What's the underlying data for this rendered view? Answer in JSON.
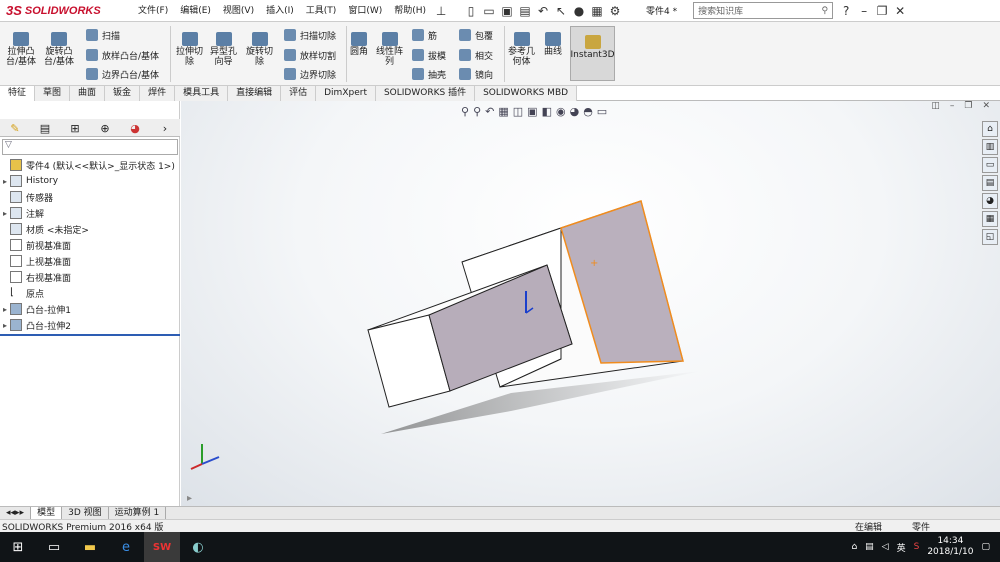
{
  "app": {
    "brand": "SOLIDWORKS"
  },
  "menubar": {
    "items": [
      "文件(F)",
      "编辑(E)",
      "视图(V)",
      "插入(I)",
      "工具(T)",
      "窗口(W)",
      "帮助(H)"
    ],
    "doc_title": "零件4 *",
    "search_placeholder": "搜索知识库"
  },
  "ribbon": {
    "large": [
      "拉伸凸\n台/基体",
      "旋转凸\n台/基体",
      "拉伸切\n除",
      "异型孔\n向导",
      "旋转切\n除",
      "圆角",
      "线性阵\n列",
      "参考几\n何体",
      "曲线"
    ],
    "small": [
      "扫描",
      "放样凸台/基体",
      "边界凸台/基体",
      "扫描切除",
      "放样切割",
      "边界切除",
      "筋",
      "拔模",
      "抽壳",
      "包覆",
      "相交",
      "镜向"
    ],
    "instant3d": "Instant3D"
  },
  "command_tabs": [
    "特征",
    "草图",
    "曲面",
    "钣金",
    "焊件",
    "模具工具",
    "直接编辑",
    "评估",
    "DimXpert",
    "SOLIDWORKS 插件",
    "SOLIDWORKS MBD"
  ],
  "feature_tree": {
    "root": "零件4 (默认<<默认>_显示状态 1>)",
    "items": [
      {
        "label": "History",
        "expand": true
      },
      {
        "label": "传感器",
        "expand": false
      },
      {
        "label": "注解",
        "expand": true
      },
      {
        "label": "材质 <未指定>",
        "expand": false
      },
      {
        "label": "前视基准面",
        "expand": false
      },
      {
        "label": "上视基准面",
        "expand": false
      },
      {
        "label": "右视基准面",
        "expand": false
      },
      {
        "label": "原点",
        "expand": false
      },
      {
        "label": "凸台-拉伸1",
        "expand": true
      },
      {
        "label": "凸台-拉伸2",
        "expand": true
      }
    ]
  },
  "model_tabs": [
    "模型",
    "3D 视图",
    "运动算例 1"
  ],
  "status": {
    "text": "SOLIDWORKS Premium 2016 x64 版",
    "right1": "在编辑",
    "right2": "零件"
  },
  "taskbar": {
    "time": "14:34",
    "date": "2018/1/10",
    "ime": "英"
  },
  "colors": {
    "face": "#b9afbd",
    "edge": "#f08c1e"
  }
}
